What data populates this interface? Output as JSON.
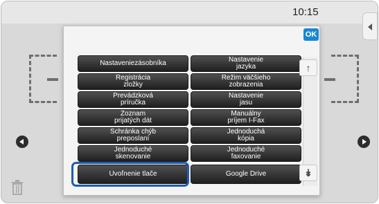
{
  "status_bar": {
    "time": "10:15"
  },
  "dialog": {
    "ok_label": "OK",
    "tiles": [
      "Nastaveniezásobníka",
      "Nastavenie\njazyka",
      "Registrácia\nzložky",
      "Režim väčšieho\nzobrazenia",
      "Prevádzková\npríručka",
      "Nastavenie\njasu",
      "Zoznam\nprijatých dát",
      "Manuálny\npríjem I-Fax",
      "Schránka chýb\npreposlaní",
      "Jednoduchá\nkópia",
      "Jednoduché\nskenovanie",
      "Jednoduché\nfaxovanie",
      "Uvoľnenie tlače",
      "Google Drive"
    ],
    "selected_tile": "Uvoľnenie tlače"
  },
  "icons": {
    "scroll_up": "scroll-up-icon",
    "scroll_down": "scroll-down-icon",
    "nav_left": "arrow-left-icon",
    "nav_right": "arrow-right-icon",
    "trash": "trash-icon"
  },
  "colors": {
    "accent": "#1a86d0",
    "selection": "#1f5bb3",
    "tile_dark": "#262626"
  }
}
